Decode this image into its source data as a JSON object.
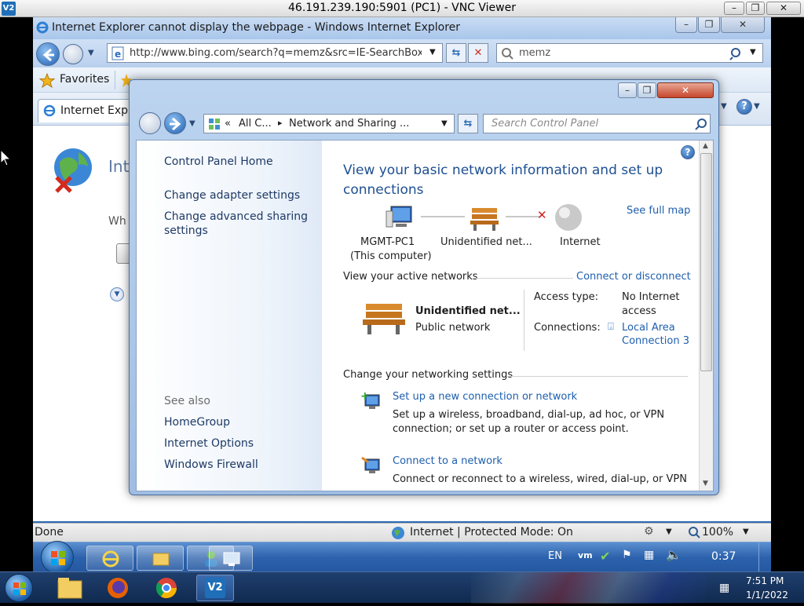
{
  "vnc": {
    "title": "46.191.239.190:5901 (PC1) - VNC Viewer",
    "icon": "vnc-icon"
  },
  "ie": {
    "title": "Internet Explorer cannot display the webpage - Windows Internet Explorer",
    "address": "http://www.bing.com/search?q=memz&src=IE-SearchBox&",
    "search_value": "memz",
    "favorites_label": "Favorites",
    "tab_label": "Internet Explor",
    "page_heading_partial": "Int",
    "page_text_partial": "Wh",
    "status_text": "Done",
    "zone_text": "Internet | Protected Mode: On",
    "zoom": "100%",
    "taskbar_clock": "0:37",
    "taskbar_lang": "EN"
  },
  "cp": {
    "breadcrumb_prefix": "«",
    "breadcrumb_1": "All C...",
    "breadcrumb_sep": "▸",
    "breadcrumb_2": "Network and Sharing ...",
    "search_placeholder": "Search Control Panel",
    "left_nav": {
      "home": "Control Panel Home",
      "adapter": "Change adapter settings",
      "advanced_1": "Change advanced sharing",
      "advanced_2": "settings",
      "see_also": "See also",
      "homegroup": "HomeGroup",
      "internet_options": "Internet Options",
      "firewall": "Windows Firewall"
    },
    "heading_1": "View your basic network information and set up",
    "heading_2": "connections",
    "see_full_map": "See full map",
    "map": {
      "computer_1": "MGMT-PC1",
      "computer_2": "(This computer)",
      "network": "Unidentified net...",
      "internet": "Internet"
    },
    "active_networks_label": "View your active networks",
    "connect_or_disconnect": "Connect or disconnect",
    "active": {
      "name": "Unidentified net...",
      "type": "Public network",
      "access_type_label": "Access type:",
      "access_type_1": "No Internet",
      "access_type_2": "access",
      "connections_label": "Connections:",
      "connection_1": "Local Area",
      "connection_2": "Connection 3"
    },
    "change_settings_label": "Change your networking settings",
    "tasks": [
      {
        "title": "Set up a new connection or network",
        "desc_1": "Set up a wireless, broadband, dial-up, ad hoc, or VPN",
        "desc_2": "connection; or set up a router or access point."
      },
      {
        "title": "Connect to a network",
        "desc_1": "Connect or reconnect to a wireless, wired, dial-up, or VPN"
      }
    ]
  },
  "host_tray": {
    "time": "7:51 PM",
    "date": "1/1/2022"
  },
  "colors": {
    "link": "#1e5fae",
    "heading": "#1e4f91",
    "taskbar": "#2c62ac"
  }
}
